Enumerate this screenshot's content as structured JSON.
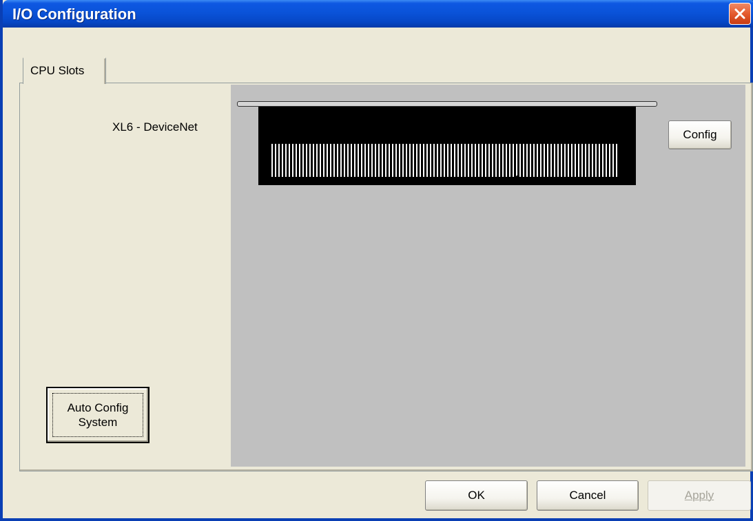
{
  "window": {
    "title": "I/O Configuration"
  },
  "tabs": [
    {
      "label": "CPU Slots",
      "active": true
    }
  ],
  "slots": [
    {
      "label": "XL6 - DeviceNet",
      "config_label": "Config"
    }
  ],
  "panel": {
    "auto_config_line1": "Auto Config",
    "auto_config_line2": "System"
  },
  "footer": {
    "ok_label": "OK",
    "cancel_label": "Cancel",
    "apply_label": "Apply"
  },
  "icons": {
    "close": "close-icon"
  },
  "colors": {
    "titlebar": "#0a53d9",
    "rack_background": "#c0c0c0",
    "module": "#000000",
    "close_button": "#e45a2e"
  }
}
